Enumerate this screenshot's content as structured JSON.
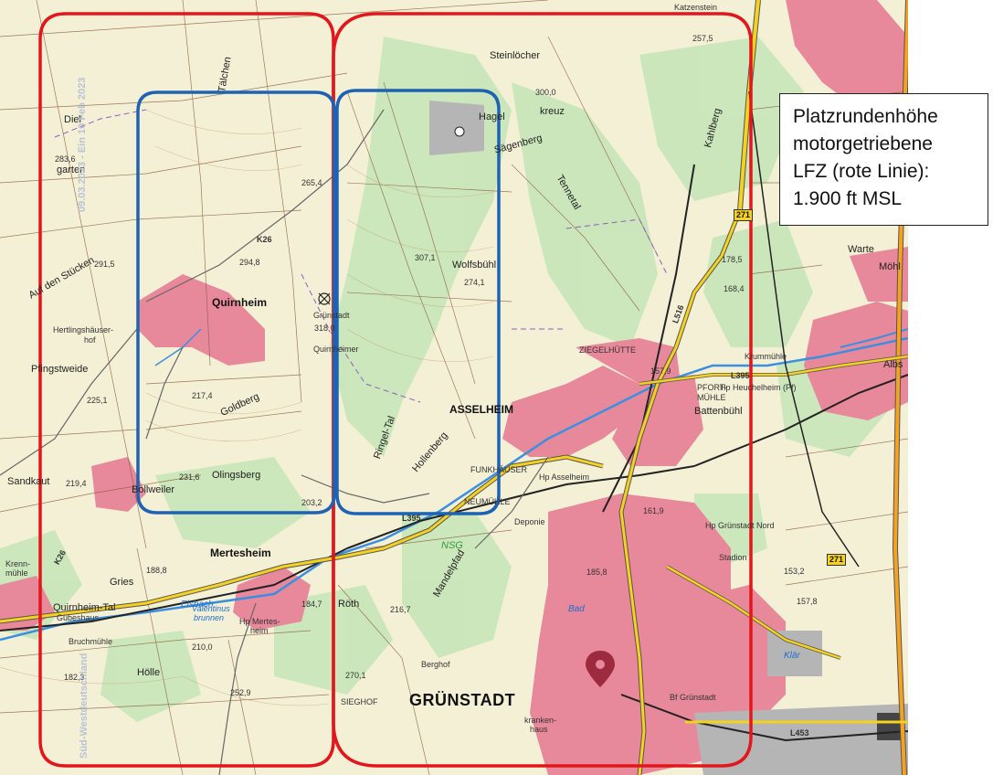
{
  "map": {
    "colors": {
      "background": "#f4f0d6",
      "settlement": "#e8889b",
      "forest": "#bfe3b2",
      "vineyard_dot": "#2f9a3a",
      "road_main": "#f6d21e",
      "river": "#3b8fe0",
      "traffic_circuit": "#e3161c",
      "circuit_blue": "#1d62b4"
    },
    "labels": {
      "diel": "Diel",
      "garten": "garten",
      "talchen": "Tälchen",
      "steinloecher": "Steinlöcher",
      "hagel": "Hagel",
      "kreuz": "kreuz",
      "saegenberg": "Sägenberg",
      "tennetal": "Tennetal",
      "kahlenberg": "Kahlberg",
      "warte": "Warte",
      "moehl": "Möhl",
      "auf_den_stuecken": "Auf den Stücken",
      "quirnheim": "Quirnheim",
      "gruenstadt_small": "Grünstadt",
      "quirnheimer": "Quirnheimer",
      "hertlingshaeuser": "Hertlingshäuser-",
      "hof": "hof",
      "pfingstweide": "Pfingstweide",
      "wolfsbuehl": "Wolfsbühl",
      "ziegelhuette": "ZIEGELHÜTTE",
      "kruemuehle": "Krummühle",
      "albs": "Albs",
      "pfortmuehle": "PFORT-",
      "muehle": "MÜHLE",
      "asselheim": "ASSELHEIM",
      "battenbuehl": "Battenbühl",
      "goldberg": "Goldberg",
      "sandkaut": "Sandkaut",
      "bollweiler": "Bollweiler",
      "olingsberg": "Olingsberg",
      "funkhaeuser": "FUNKHÄUSER",
      "neumuehle": "NEUMÜHLE",
      "mertesheim": "Mertesheim",
      "gries": "Gries",
      "nsg": "NSG",
      "mandelpfad": "Mandelpfad",
      "roth": "Röth",
      "quirnheim_tal": "Quirnheim-Tal",
      "eisbach": "Eisbach",
      "valentinus": "Valentinus",
      "brunnen": "brunnen",
      "hoelle": "Hölle",
      "berghof": "Berghof",
      "sieghof": "SIEGHOF",
      "gruenstadt": "GRÜNSTADT",
      "bad": "Bad",
      "krankenhaus": "kranken-",
      "haus": "haus",
      "hp_asselheim": "Hp Asselheim",
      "hp_mertesheim": "Hp Mertes-",
      "heim": "heim",
      "deponie": "Deponie",
      "hp_gruenstadt_nord": "Hp Grünstadt Nord",
      "stadion": "Stadion",
      "klaer": "Klär",
      "bf_gruenstadt": "Bf Grünstadt",
      "hp_heuchelheim": "Hp Heuchelheim (Pf)",
      "kremerhof": "Krenn-",
      "muehle2": "mühle",
      "gebaeudehaus": "Gübeshaus",
      "bruchmuehle": "Bruchmühle",
      "heiligenberg": "Hollenberg",
      "ringelstal": "Ringel-Tal",
      "katzenstein": "Katzenstein"
    },
    "road_badges": {
      "b271_north": "271",
      "b271_south": "271",
      "l395": "L395",
      "l453": "L453",
      "l516": "L516",
      "l395b": "L395",
      "k26": "K26",
      "k26b": "K26"
    },
    "elevations": {
      "e1": "283,6",
      "e2": "291,5",
      "e3": "294,8",
      "e4": "307,1",
      "e5": "274,1",
      "e6": "300,0",
      "e7": "257,5",
      "e8": "178,5",
      "e9": "168,4",
      "e10": "157,9",
      "e11": "225,1",
      "e12": "217,4",
      "e13": "231,6",
      "e14": "219,4",
      "e15": "203,2",
      "e16": "188,8",
      "e17": "184,7",
      "e18": "216,7",
      "e19": "270,1",
      "e20": "252,9",
      "e21": "182,3",
      "e22": "153,2",
      "e23": "157,8",
      "e24": "161,9",
      "e25": "185,8",
      "e26": "210,0",
      "e27": "265,4",
      "e28": "318,0"
    },
    "watermark": "09.03.2023 - Ein 10 Feb 2023",
    "watermark2": "Süd-Westdeutschland"
  },
  "info_box": {
    "line1": "Platzrundenhöhe",
    "line2": "motorgetriebene",
    "line3": "LFZ (rote Linie):",
    "line4": "1.900 ft MSL"
  }
}
